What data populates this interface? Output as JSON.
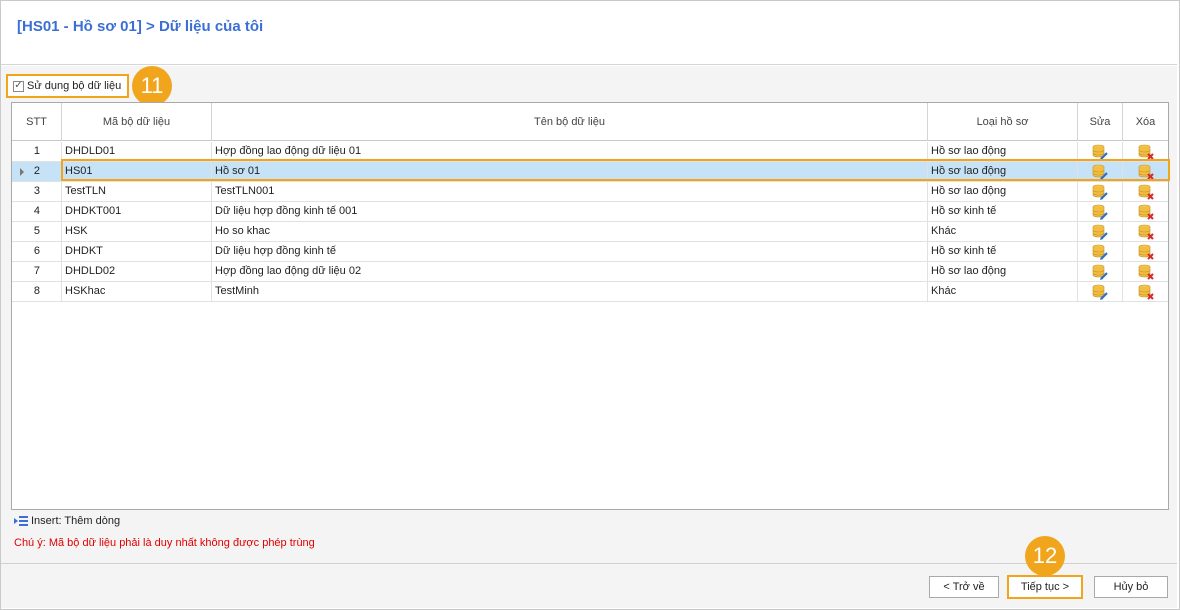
{
  "header": {
    "title": "[HS01 - Hồ sơ 01] > Dữ liệu của tôi"
  },
  "use_dataset": {
    "label": "Sử dụng bộ dữ liệu",
    "checked": true,
    "step": "11"
  },
  "grid": {
    "columns": {
      "stt": "STT",
      "code": "Mã bộ dữ liệu",
      "name": "Tên bộ dữ liệu",
      "type": "Loại hồ sơ",
      "edit": "Sửa",
      "delete": "Xóa"
    },
    "selected_index": 1,
    "rows": [
      {
        "stt": "1",
        "code": "DHDLD01",
        "name": "Hợp đồng lao động dữ liệu 01",
        "type": "Hồ sơ lao động"
      },
      {
        "stt": "2",
        "code": "HS01",
        "name": "Hồ sơ 01",
        "type": "Hồ sơ lao động"
      },
      {
        "stt": "3",
        "code": "TestTLN",
        "name": "TestTLN001",
        "type": "Hồ sơ lao động"
      },
      {
        "stt": "4",
        "code": "DHDKT001",
        "name": "Dữ liệu hợp đồng kinh tế 001",
        "type": "Hồ sơ kinh tế"
      },
      {
        "stt": "5",
        "code": "HSK",
        "name": "Ho so khac",
        "type": "Khác"
      },
      {
        "stt": "6",
        "code": "DHDKT",
        "name": "Dữ liệu hợp đồng kinh tế",
        "type": "Hồ sơ kinh tế"
      },
      {
        "stt": "7",
        "code": "DHDLD02",
        "name": "Hợp đồng lao động dữ liệu 02",
        "type": "Hồ sơ lao động"
      },
      {
        "stt": "8",
        "code": "HSKhac",
        "name": "TestMinh",
        "type": "Khác"
      }
    ],
    "edit_icon": "database-edit-icon",
    "delete_icon": "database-delete-icon"
  },
  "hints": {
    "insert": "Insert: Thêm dòng",
    "note": "Chú ý: Mã bộ dữ liệu phải là duy nhất không được phép trùng"
  },
  "footer": {
    "back": "< Trở về",
    "next": "Tiếp tục >",
    "cancel": "Hủy bỏ",
    "step": "12"
  },
  "colors": {
    "title": "#3b6fd6",
    "highlight": "#f0a51c",
    "selected_row": "#c6e2f7",
    "note": "#e00000"
  }
}
